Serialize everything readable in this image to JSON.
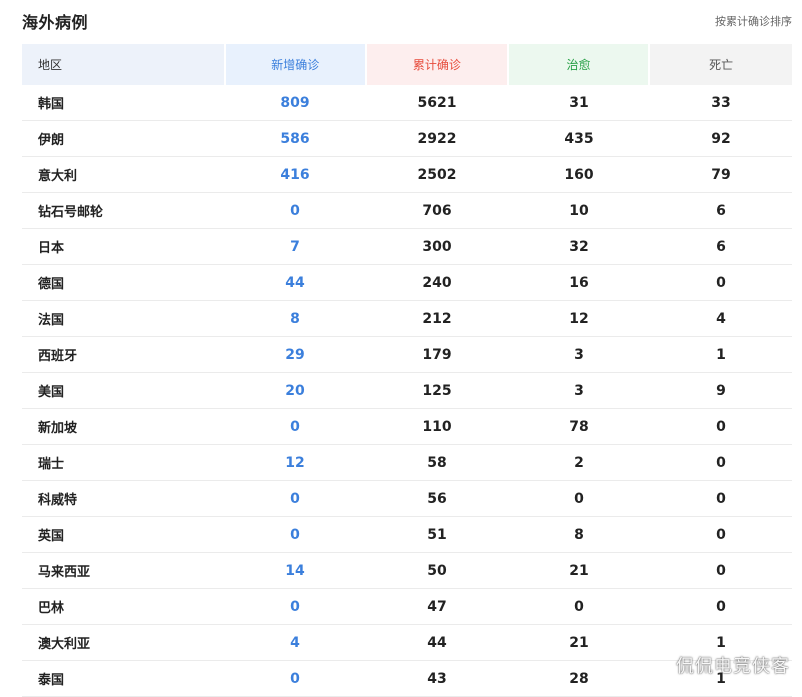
{
  "header": {
    "title": "海外病例",
    "sort_note": "按累计确诊排序"
  },
  "table": {
    "columns": {
      "region": "地区",
      "new_confirmed": "新增确诊",
      "total_confirmed": "累计确诊",
      "cured": "治愈",
      "deaths": "死亡"
    },
    "rows": [
      {
        "region": "韩国",
        "new": "809",
        "total": "5621",
        "cured": "31",
        "deaths": "33"
      },
      {
        "region": "伊朗",
        "new": "586",
        "total": "2922",
        "cured": "435",
        "deaths": "92"
      },
      {
        "region": "意大利",
        "new": "416",
        "total": "2502",
        "cured": "160",
        "deaths": "79"
      },
      {
        "region": "钻石号邮轮",
        "new": "0",
        "total": "706",
        "cured": "10",
        "deaths": "6"
      },
      {
        "region": "日本",
        "new": "7",
        "total": "300",
        "cured": "32",
        "deaths": "6"
      },
      {
        "region": "德国",
        "new": "44",
        "total": "240",
        "cured": "16",
        "deaths": "0"
      },
      {
        "region": "法国",
        "new": "8",
        "total": "212",
        "cured": "12",
        "deaths": "4"
      },
      {
        "region": "西班牙",
        "new": "29",
        "total": "179",
        "cured": "3",
        "deaths": "1"
      },
      {
        "region": "美国",
        "new": "20",
        "total": "125",
        "cured": "3",
        "deaths": "9"
      },
      {
        "region": "新加坡",
        "new": "0",
        "total": "110",
        "cured": "78",
        "deaths": "0"
      },
      {
        "region": "瑞士",
        "new": "12",
        "total": "58",
        "cured": "2",
        "deaths": "0"
      },
      {
        "region": "科威特",
        "new": "0",
        "total": "56",
        "cured": "0",
        "deaths": "0"
      },
      {
        "region": "英国",
        "new": "0",
        "total": "51",
        "cured": "8",
        "deaths": "0"
      },
      {
        "region": "马来西亚",
        "new": "14",
        "total": "50",
        "cured": "21",
        "deaths": "0"
      },
      {
        "region": "巴林",
        "new": "0",
        "total": "47",
        "cured": "0",
        "deaths": "0"
      },
      {
        "region": "澳大利亚",
        "new": "4",
        "total": "44",
        "cured": "21",
        "deaths": "1"
      },
      {
        "region": "泰国",
        "new": "0",
        "total": "43",
        "cured": "28",
        "deaths": "1"
      }
    ]
  },
  "watermark": "侃侃电竞侠客",
  "colors": {
    "new_confirmed": "#3b7fdc",
    "total_confirmed": "#e74c3c",
    "cured": "#27a046",
    "deaths": "#555555"
  }
}
